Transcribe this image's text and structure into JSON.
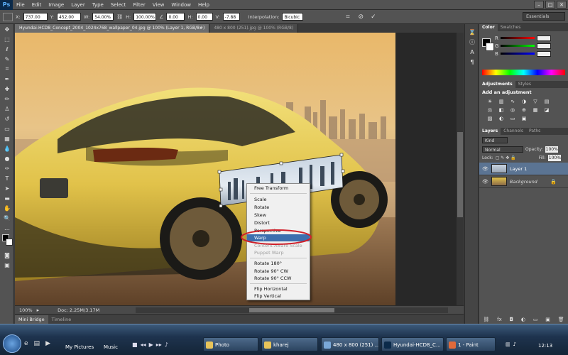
{
  "app": {
    "logo": "Ps"
  },
  "menu": [
    "File",
    "Edit",
    "Image",
    "Layer",
    "Type",
    "Select",
    "Filter",
    "View",
    "Window",
    "Help"
  ],
  "options": {
    "x_label": "X:",
    "x_value": "737.00 px",
    "y_label": "Y:",
    "y_value": "452.00 px",
    "w_label": "W:",
    "w_value": "54.00%",
    "h_label": "H:",
    "h_value": "100.00%",
    "angle_value": "0.00",
    "hskew_label": "H:",
    "hskew_value": "0.00",
    "vskew_label": "V:",
    "vskew_value": "-7.88",
    "interp_label": "Interpolation:",
    "interp_value": "Bicubic",
    "workspace": "Essentials"
  },
  "tabs": [
    {
      "label": "Hyundai-HCD8_Concept_2004_1024x768_wallpaper_04.jpg @ 100% (Layer 1, RGB/8#)",
      "active": true
    },
    {
      "label": "480 x 800 (251).jpg @ 100% (RGB/8)",
      "active": false
    }
  ],
  "context_menu": [
    {
      "label": "Free Transform",
      "state": "normal"
    },
    {
      "label": "Scale",
      "state": "normal"
    },
    {
      "label": "Rotate",
      "state": "normal"
    },
    {
      "label": "Skew",
      "state": "normal"
    },
    {
      "label": "Distort",
      "state": "normal"
    },
    {
      "label": "Perspective",
      "state": "normal"
    },
    {
      "label": "Warp",
      "state": "highlighted"
    },
    {
      "label": "Content-Aware Scale",
      "state": "disabled"
    },
    {
      "label": "Puppet Warp",
      "state": "disabled"
    },
    {
      "label": "Rotate 180°",
      "state": "normal"
    },
    {
      "label": "Rotate 90° CW",
      "state": "normal"
    },
    {
      "label": "Rotate 90° CCW",
      "state": "normal"
    },
    {
      "label": "Flip Horizontal",
      "state": "normal"
    },
    {
      "label": "Flip Vertical",
      "state": "normal"
    }
  ],
  "status": {
    "zoom": "100%",
    "doc": "Doc: 2.25M/3.17M"
  },
  "bottom_tabs": [
    {
      "label": "Mini Bridge"
    },
    {
      "label": "Timeline"
    }
  ],
  "panels": {
    "color_tabs": [
      "Color",
      "Swatches"
    ],
    "color_channels": [
      "R",
      "G",
      "B"
    ],
    "adjust_tabs": [
      "Adjustments",
      "Styles"
    ],
    "adjust_hint": "Add an adjustment",
    "layers_tabs": [
      "Layers",
      "Channels",
      "Paths"
    ],
    "kind_label": "Kind",
    "blend_mode": "Normal",
    "opacity_label": "Opacity:",
    "opacity_value": "100%",
    "lock_label": "Lock:",
    "fill_label": "Fill:",
    "fill_value": "100%",
    "layers": [
      {
        "name": "Layer 1",
        "selected": true
      },
      {
        "name": "Background",
        "selected": false
      }
    ]
  },
  "taskbar": {
    "items": [
      "My Pictures",
      "Music",
      "Photo",
      "kharej",
      "480 x 800 (251) ...",
      "Hyundai-HCD8_C...",
      "1 - Paint"
    ],
    "clock": "12:13"
  },
  "accent": {
    "highlight": "#3d6fae",
    "annotation": "#d0202a"
  }
}
